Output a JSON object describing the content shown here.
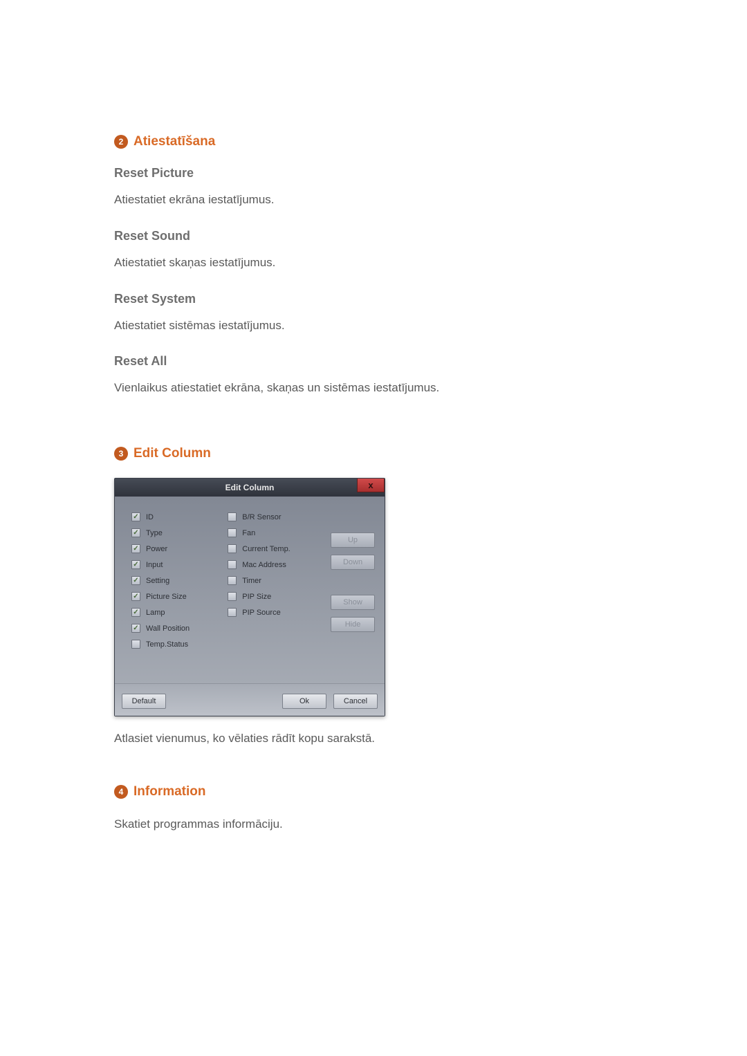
{
  "section2": {
    "badge": "2",
    "title": "Atiestatīšana",
    "items": [
      {
        "heading": "Reset Picture",
        "text": "Atiestatiet ekrāna iestatījumus."
      },
      {
        "heading": "Reset Sound",
        "text": "Atiestatiet skaņas iestatījumus."
      },
      {
        "heading": "Reset System",
        "text": "Atiestatiet sistēmas iestatījumus."
      },
      {
        "heading": "Reset All",
        "text": "Vienlaikus atiestatiet ekrāna, skaņas un sistēmas iestatījumus."
      }
    ]
  },
  "section3": {
    "badge": "3",
    "title": "Edit Column",
    "dialog": {
      "title": "Edit Column",
      "close": "x",
      "left": [
        {
          "label": "ID",
          "checked": true
        },
        {
          "label": "Type",
          "checked": true
        },
        {
          "label": "Power",
          "checked": true
        },
        {
          "label": "Input",
          "checked": true
        },
        {
          "label": "Setting",
          "checked": true
        },
        {
          "label": "Picture Size",
          "checked": true
        },
        {
          "label": "Lamp",
          "checked": true
        },
        {
          "label": "Wall Position",
          "checked": true
        },
        {
          "label": "Temp.Status",
          "checked": false
        }
      ],
      "mid": [
        {
          "label": "B/R Sensor",
          "checked": false
        },
        {
          "label": "Fan",
          "checked": false
        },
        {
          "label": "Current Temp.",
          "checked": false
        },
        {
          "label": "Mac Address",
          "checked": false
        },
        {
          "label": "Timer",
          "checked": false
        },
        {
          "label": "PIP Size",
          "checked": false
        },
        {
          "label": "PIP Source",
          "checked": false
        }
      ],
      "buttons": {
        "up": "Up",
        "down": "Down",
        "show": "Show",
        "hide": "Hide",
        "default": "Default",
        "ok": "Ok",
        "cancel": "Cancel"
      }
    },
    "caption": "Atlasiet vienumus, ko vēlaties rādīt kopu sarakstā."
  },
  "section4": {
    "badge": "4",
    "title": "Information",
    "text": "Skatiet programmas informāciju."
  }
}
